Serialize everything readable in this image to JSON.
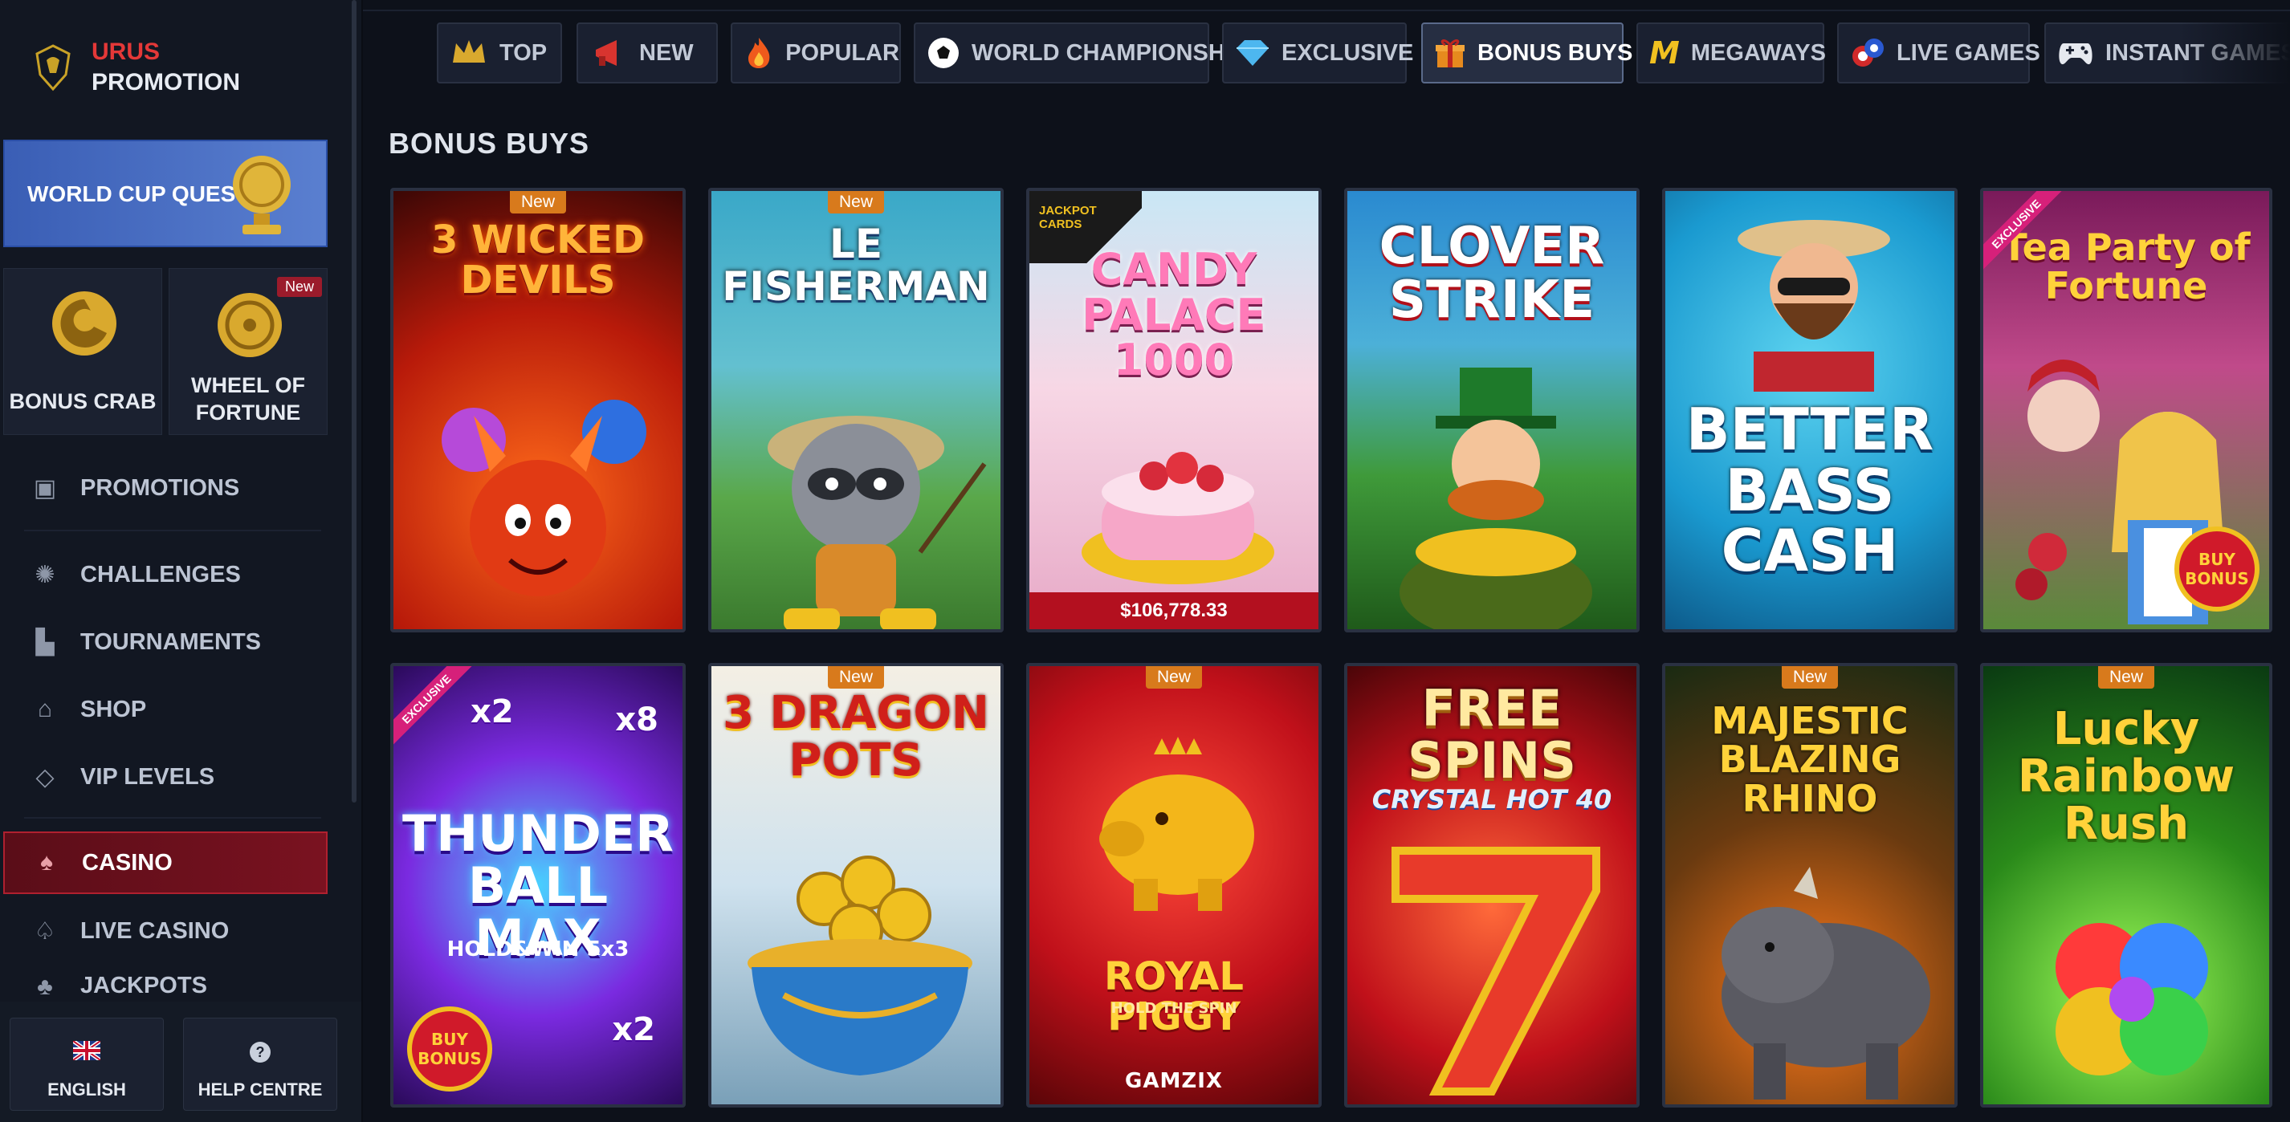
{
  "sidebar": {
    "brand": {
      "line1": "URUS",
      "line2": "PROMOTION"
    },
    "quest": {
      "label": "WORLD CUP QUEST"
    },
    "tiles": [
      {
        "label": "BONUS CRAB"
      },
      {
        "label": "WHEEL OF FORTUNE",
        "badge": "New"
      }
    ],
    "menu": [
      {
        "label": "PROMOTIONS"
      },
      {
        "label": "CHALLENGES"
      },
      {
        "label": "TOURNAMENTS"
      },
      {
        "label": "SHOP"
      },
      {
        "label": "VIP LEVELS"
      },
      {
        "label": "CASINO"
      },
      {
        "label": "LIVE CASINO"
      },
      {
        "label": "JACKPOTS"
      }
    ],
    "bottom": {
      "language": "ENGLISH",
      "help": "HELP CENTRE"
    }
  },
  "tabs": [
    {
      "label": "TOP",
      "icon": "crown-icon"
    },
    {
      "label": "NEW",
      "icon": "megaphone-icon"
    },
    {
      "label": "POPULAR",
      "icon": "fire-icon"
    },
    {
      "label": "WORLD CHAMPIONSHIP",
      "icon": "soccer-ball-icon"
    },
    {
      "label": "EXCLUSIVE",
      "icon": "diamond-icon"
    },
    {
      "label": "BONUS BUYS",
      "icon": "gift-icon",
      "active": true
    },
    {
      "label": "MEGAWAYS",
      "icon": "megaways-m-icon"
    },
    {
      "label": "LIVE GAMES",
      "icon": "casino-chips-icon"
    },
    {
      "label": "INSTANT GAMES",
      "icon": "gamepad-icon"
    }
  ],
  "section": {
    "title": "BONUS BUYS"
  },
  "games": [
    {
      "title": "3 WICKED DEVILS",
      "badge": "New"
    },
    {
      "title": "LE FISHERMAN",
      "badge": "New"
    },
    {
      "title": "CANDY PALACE 1000",
      "corner": "JACKPOT CARDS",
      "jackpot": "$106,778.33"
    },
    {
      "title": "CLOVER STRIKE"
    },
    {
      "title": "BETTER BASS CASH"
    },
    {
      "title": "Tea Party of Fortune",
      "corner": "EXCLUSIVE",
      "stamp": "BUY BONUS"
    },
    {
      "title": "THUNDER BALL MAX",
      "sub": "HOLD&WIN 5x3",
      "corner": "EXCLUSIVE",
      "stamp": "BUY BONUS",
      "mult1": "x2",
      "mult2": "x8",
      "mult3": "x2"
    },
    {
      "title": "3 DRAGON POTS",
      "badge": "New"
    },
    {
      "title": "ROYAL PIGGY",
      "sub": "HOLD THE SPIN",
      "badge": "New",
      "brand": "GAMZIX"
    },
    {
      "title": "FREE SPINS",
      "sub": "CRYSTAL HOT 40"
    },
    {
      "title": "MAJESTIC BLAZING RHINO",
      "badge": "New"
    },
    {
      "title": "Lucky Rainbow Rush",
      "badge": "New"
    }
  ]
}
